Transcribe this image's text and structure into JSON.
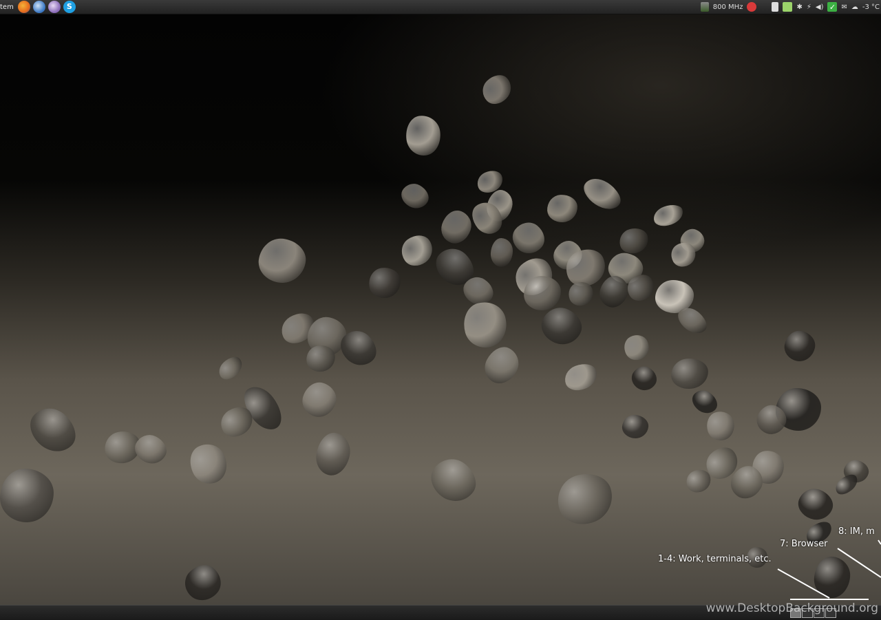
{
  "top_panel": {
    "menu_label": "tem",
    "launchers": [
      {
        "icon": "firefox-icon",
        "color": "#e66a1c"
      },
      {
        "icon": "thunderbird-icon",
        "color": "#3b78c4"
      },
      {
        "icon": "pidgin-icon",
        "color": "#8a6bb8"
      },
      {
        "icon": "skype-icon",
        "color": "#1fa0e3"
      }
    ],
    "cpu_freq": "800 MHz",
    "temperature": "-3 °C"
  },
  "annotations": {
    "work": "1-4: Work, terminals, etc.",
    "browser": "7: Browser",
    "im": "8: IM, m"
  },
  "watermark": "www.DesktopBackground.org",
  "workspaces": 4
}
